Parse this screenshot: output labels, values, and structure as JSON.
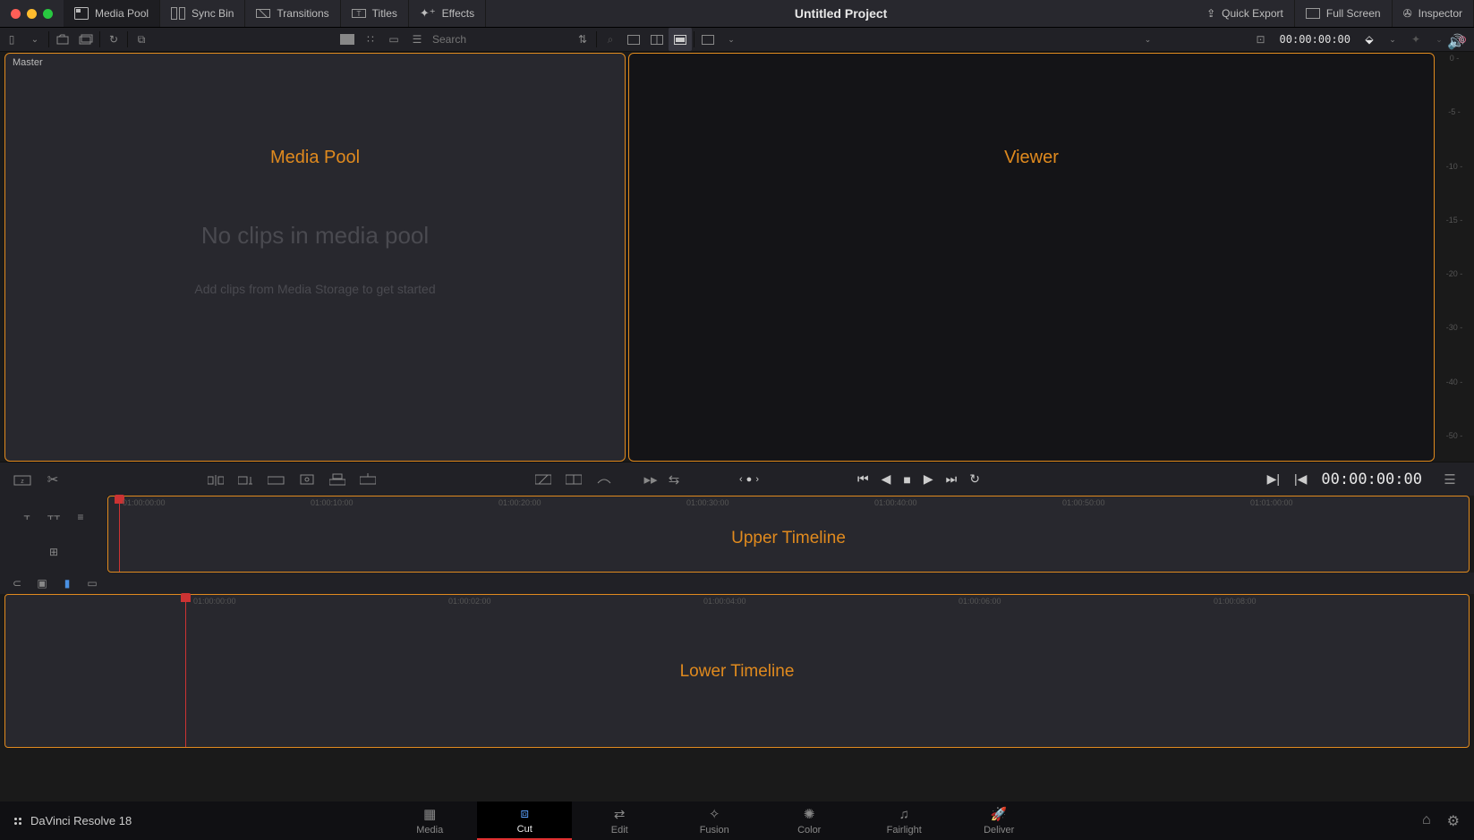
{
  "project_title": "Untitled Project",
  "menu": {
    "media_pool": "Media Pool",
    "sync_bin": "Sync Bin",
    "transitions": "Transitions",
    "titles": "Titles",
    "effects": "Effects",
    "quick_export": "Quick Export",
    "full_screen": "Full Screen",
    "inspector": "Inspector"
  },
  "toolbar": {
    "search_placeholder": "Search",
    "master_tab": "Master",
    "viewer_timecode": "00:00:00:00"
  },
  "media_pool": {
    "panel_label": "Media Pool",
    "empty_title": "No clips in media pool",
    "empty_hint": "Add clips from Media Storage to get started"
  },
  "viewer": {
    "panel_label": "Viewer"
  },
  "audio_meter": [
    "0 -",
    "-5 -",
    "-10 -",
    "-15 -",
    "-20 -",
    "-30 -",
    "-40 -",
    "-50 -"
  ],
  "transport": {
    "timecode": "00:00:00:00"
  },
  "upper_timeline": {
    "label": "Upper Timeline",
    "marks": [
      "01:00:00:00",
      "01:00:10:00",
      "01:00:20:00",
      "01:00:30:00",
      "01:00:40:00",
      "01:00:50:00",
      "01:01:00:00"
    ]
  },
  "lower_timeline": {
    "label": "Lower Timeline",
    "marks": [
      "01:00:00:00",
      "01:00:02:00",
      "01:00:04:00",
      "01:00:06:00",
      "01:00:08:00"
    ]
  },
  "app": {
    "brand": "DaVinci Resolve 18",
    "tabs": {
      "media": "Media",
      "cut": "Cut",
      "edit": "Edit",
      "fusion": "Fusion",
      "color": "Color",
      "fairlight": "Fairlight",
      "deliver": "Deliver"
    }
  }
}
